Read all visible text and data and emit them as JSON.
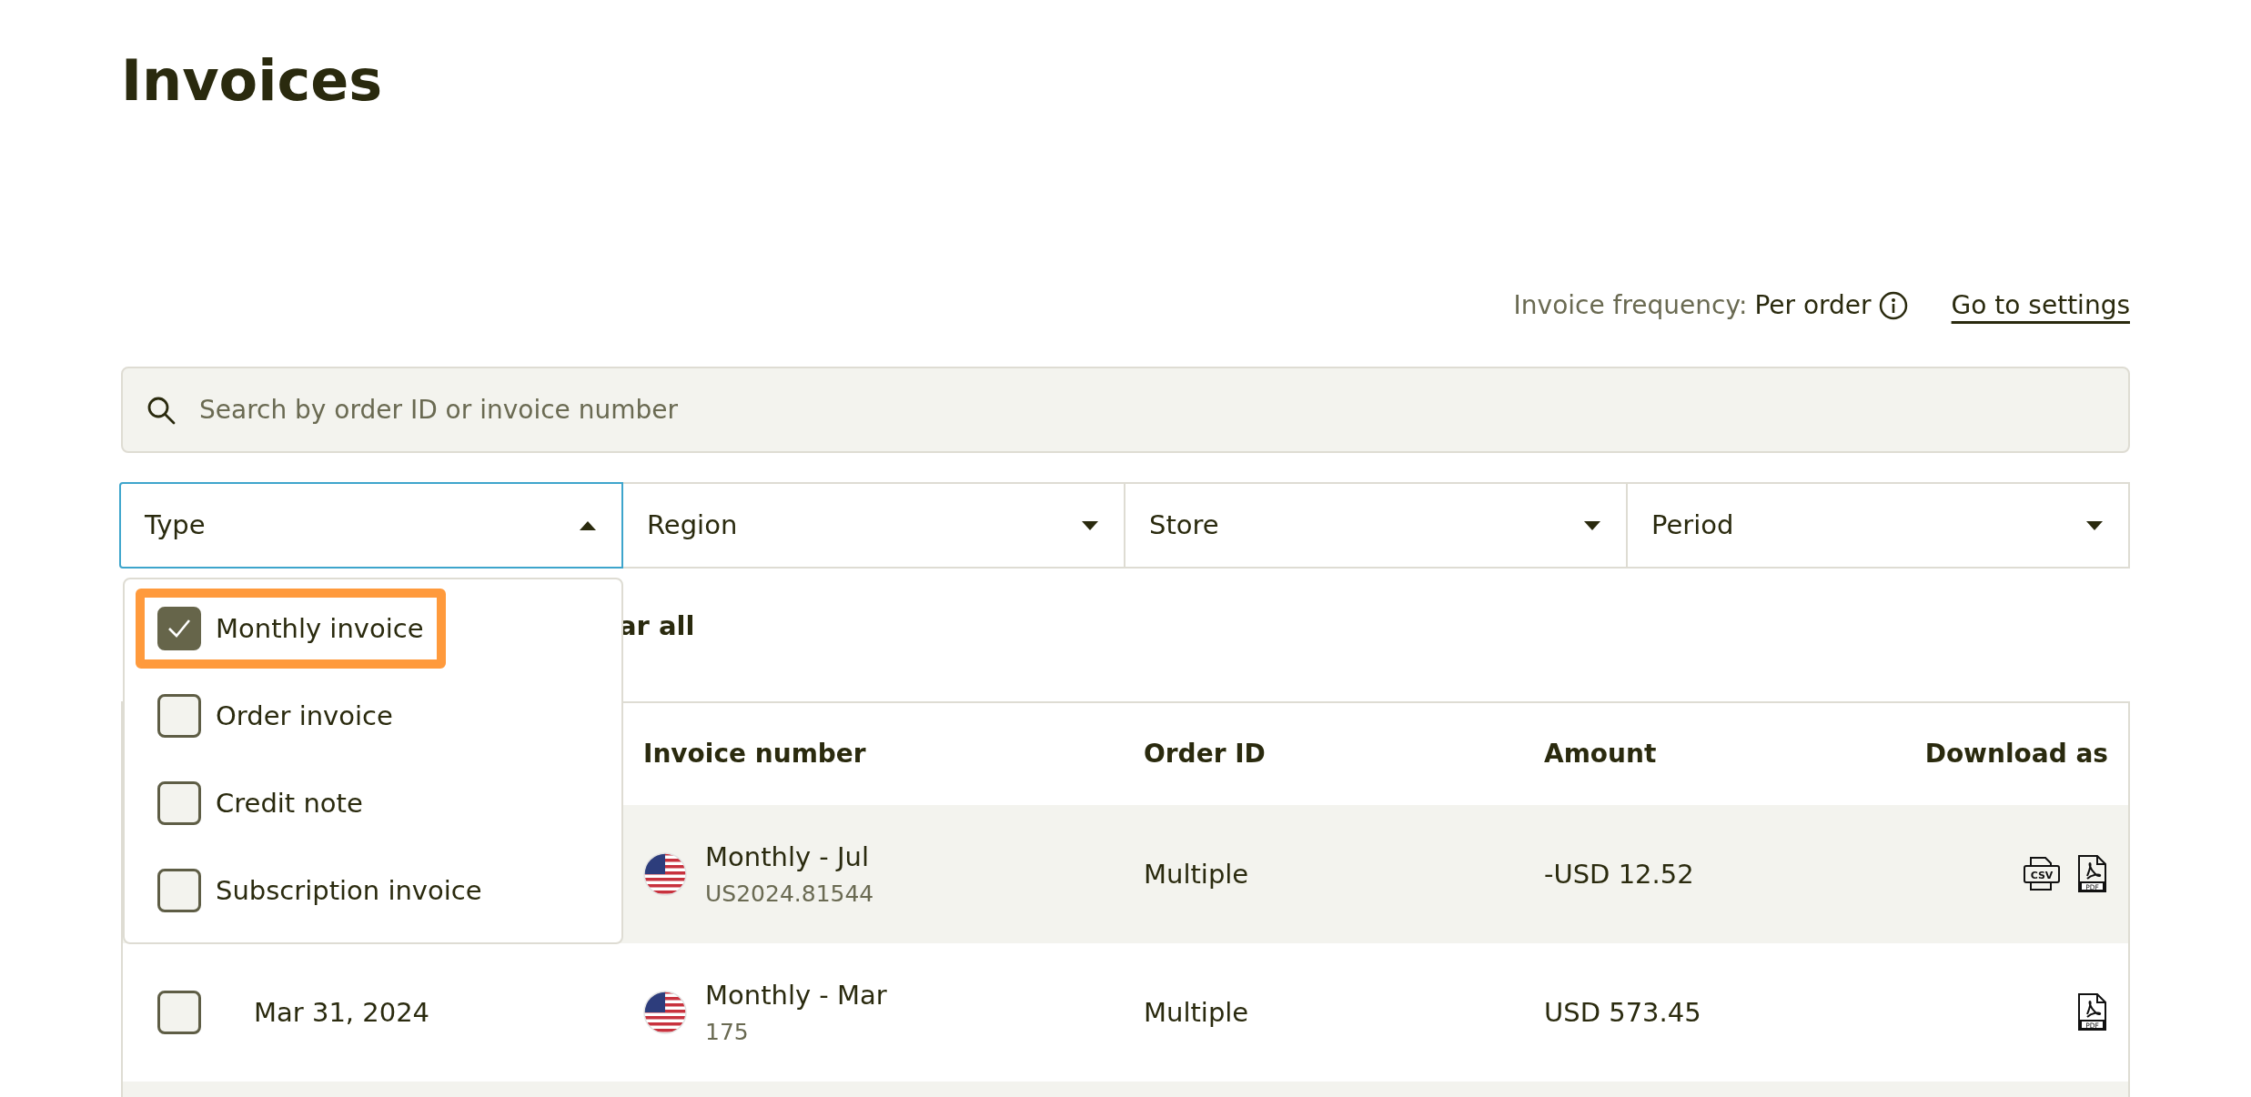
{
  "page_title": "Invoices",
  "frequency": {
    "label": "Invoice frequency:",
    "value": "Per order",
    "link": "Go to settings"
  },
  "search": {
    "placeholder": "Search by order ID or invoice number"
  },
  "filters": [
    {
      "label": "Type",
      "expanded": true
    },
    {
      "label": "Region",
      "expanded": false
    },
    {
      "label": "Store",
      "expanded": false
    },
    {
      "label": "Period",
      "expanded": false
    }
  ],
  "type_options": [
    {
      "label": "Monthly invoice",
      "checked": true,
      "highlighted": true
    },
    {
      "label": "Order invoice",
      "checked": false,
      "highlighted": false
    },
    {
      "label": "Credit note",
      "checked": false,
      "highlighted": false
    },
    {
      "label": "Subscription invoice",
      "checked": false,
      "highlighted": false
    }
  ],
  "clear_all": "ar all",
  "table": {
    "columns": [
      "Invoice number",
      "Order ID",
      "Amount",
      "Download as"
    ],
    "rows": [
      {
        "invoice_title": "Monthly - Jul",
        "invoice_number": "US2024.81544",
        "order_id": "Multiple",
        "amount": "-USD 12.52",
        "downloads": [
          {
            "kind": "csv",
            "label": "CSV"
          },
          {
            "kind": "pdf",
            "label": "PDF"
          }
        ]
      },
      {
        "checked": false,
        "date": "Mar 31, 2024",
        "invoice_title": "Monthly - Mar",
        "invoice_number": "175",
        "order_id": "Multiple",
        "amount": "USD 573.45",
        "downloads": [
          {
            "kind": "pdf",
            "label": "PDF"
          }
        ]
      }
    ]
  }
}
